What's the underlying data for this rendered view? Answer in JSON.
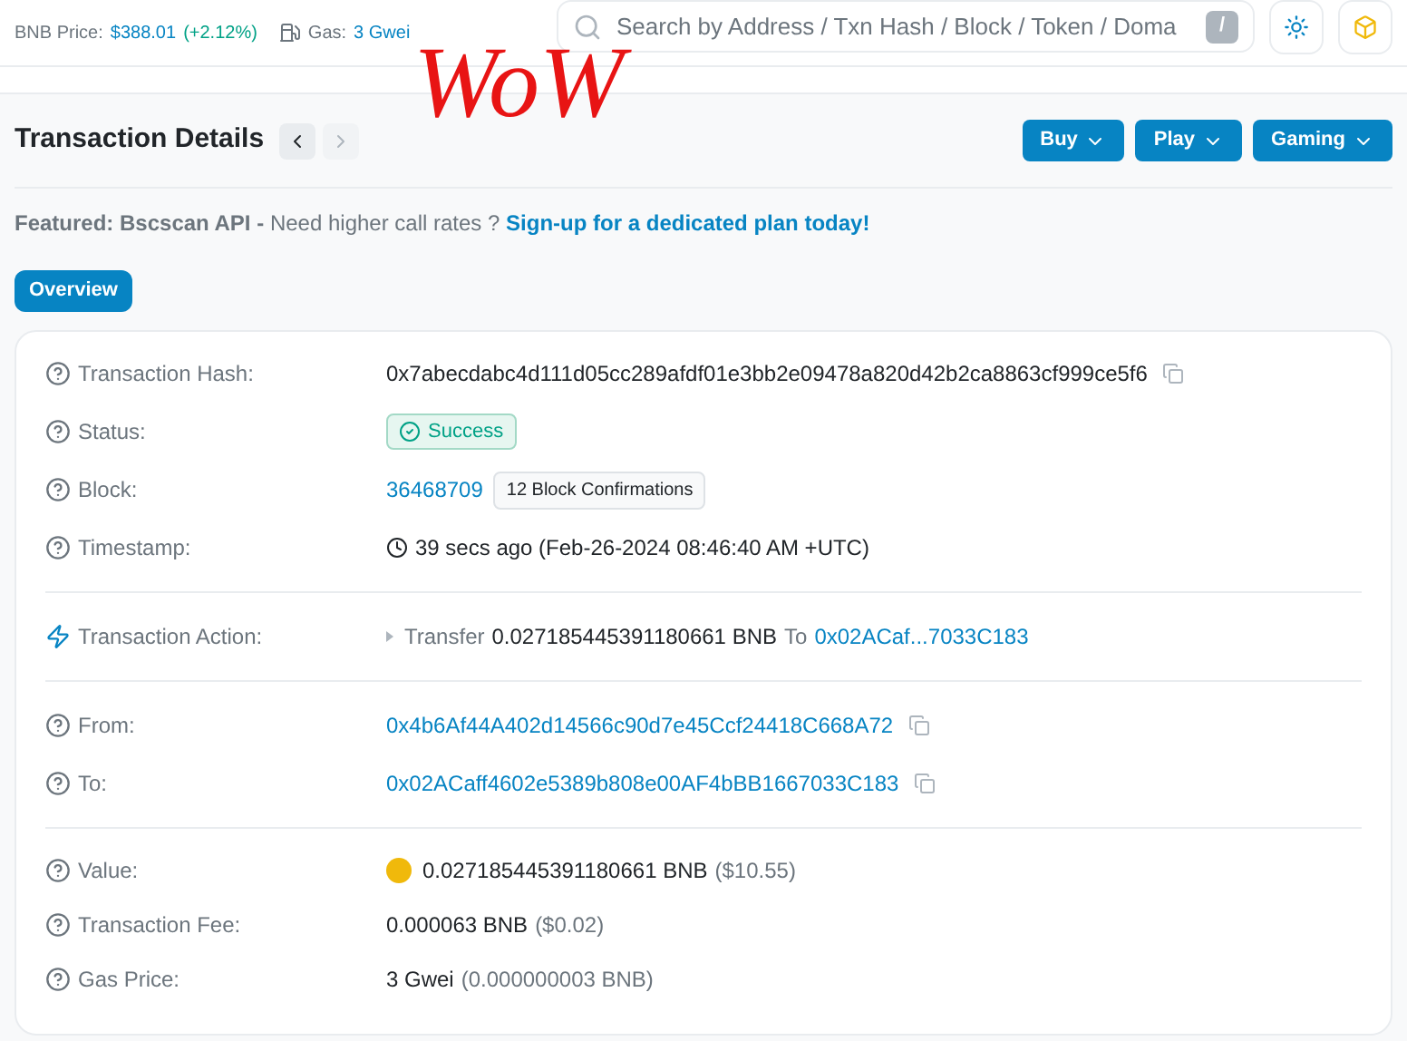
{
  "topbar": {
    "price_label": "BNB Price:",
    "price": "$388.01",
    "price_change": "(+2.12%)",
    "gas_label": "Gas:",
    "gas": "3 Gwei",
    "search": {
      "placeholder": "Search by Address / Txn Hash / Block / Token / Doma"
    },
    "search_key": "/"
  },
  "annotation": "WoW",
  "page": {
    "title": "Transaction Details",
    "menus": [
      "Buy",
      "Play",
      "Gaming"
    ]
  },
  "featured": {
    "label": "Featured: Bscscan API -",
    "text": "Need higher call rates ?",
    "link": "Sign-up for a dedicated plan today!"
  },
  "tabs": [
    {
      "label": "Overview",
      "selected": true
    }
  ],
  "sections": [
    {
      "rows": [
        {
          "kind": "hash",
          "label": "Transaction Hash:",
          "value": "0x7abecdabc4d111d05cc289afdf01e3bb2e09478a820d42b2ca8863cf999ce5f6"
        },
        {
          "kind": "status",
          "label": "Status:",
          "value": "Success"
        },
        {
          "kind": "block",
          "label": "Block:",
          "value": "36468709",
          "badge": "12 Block Confirmations"
        },
        {
          "kind": "timestamp",
          "label": "Timestamp:",
          "value": "39 secs ago (Feb-26-2024 08:46:40 AM +UTC)"
        }
      ]
    },
    {
      "rows": [
        {
          "kind": "action",
          "label": "Transaction Action:",
          "verb": "Transfer",
          "amount": "0.027185445391180661 BNB",
          "to_label": "To",
          "to": "0x02ACaf...7033C183"
        }
      ]
    },
    {
      "rows": [
        {
          "kind": "address",
          "label": "From:",
          "value": "0x4b6Af44A402d14566c90d7e45Ccf24418C668A72"
        },
        {
          "kind": "address",
          "label": "To:",
          "value": "0x02ACaff4602e5389b808e00AF4bBB1667033C183"
        }
      ]
    },
    {
      "rows": [
        {
          "kind": "value",
          "label": "Value:",
          "value": "0.027185445391180661 BNB",
          "fiat": "($10.55)"
        },
        {
          "kind": "amount",
          "label": "Transaction Fee:",
          "value": "0.000063 BNB",
          "fiat": "($0.02)"
        },
        {
          "kind": "amount",
          "label": "Gas Price:",
          "value": "3 Gwei",
          "fiat": "(0.000000003 BNB)"
        }
      ]
    }
  ]
}
